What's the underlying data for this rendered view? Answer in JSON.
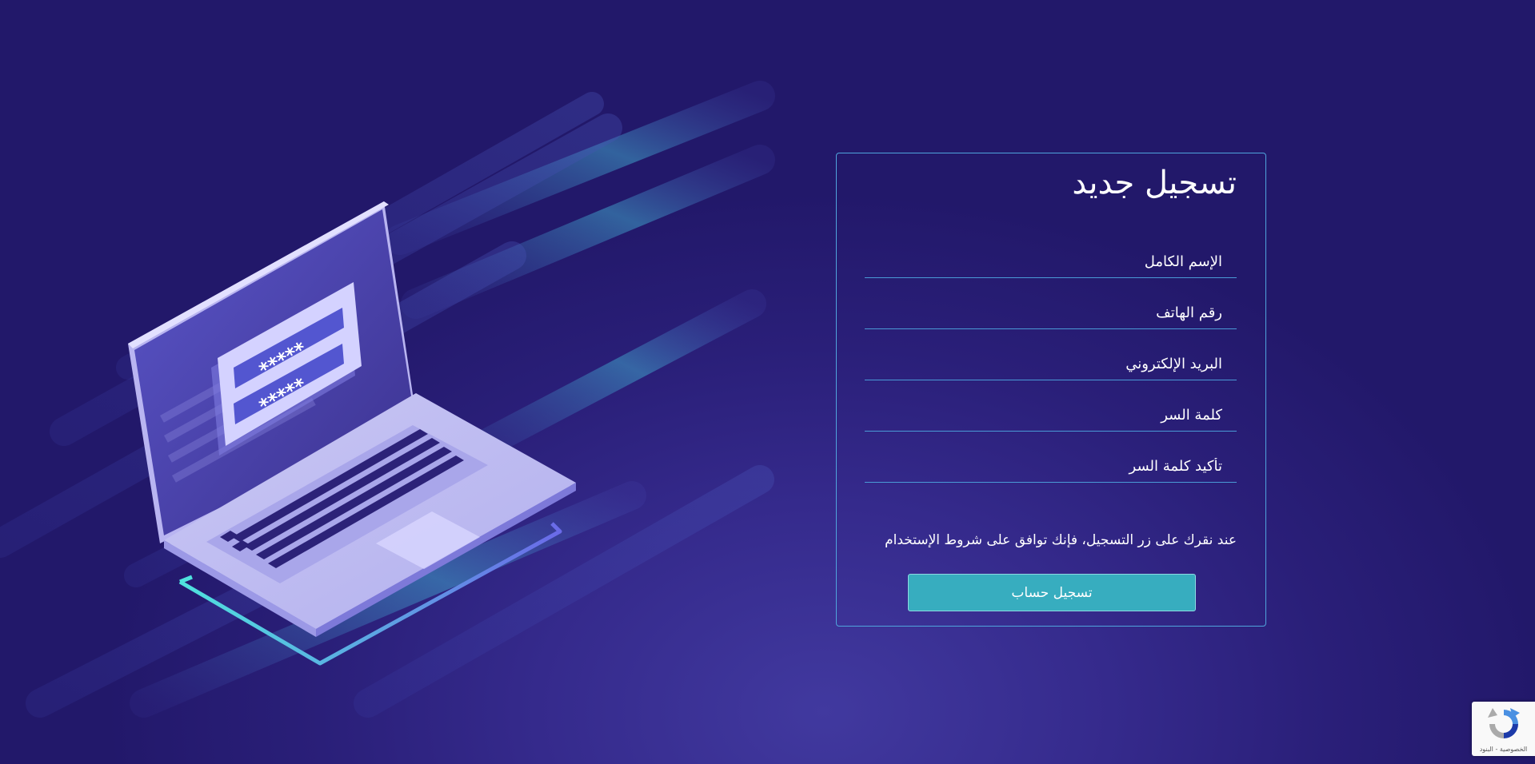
{
  "form": {
    "title": "تسجيل جديد",
    "fields": [
      {
        "name": "full-name",
        "placeholder": "الإسم الكامل",
        "value": ""
      },
      {
        "name": "phone",
        "placeholder": "رقم الهاتف",
        "value": ""
      },
      {
        "name": "email",
        "placeholder": "البريد الإلكتروني",
        "value": ""
      },
      {
        "name": "password",
        "placeholder": "كلمة السر",
        "value": ""
      },
      {
        "name": "confirm-password",
        "placeholder": "تأكيد كلمة السر",
        "value": ""
      }
    ],
    "terms_text": "عند نقرك على زر التسجيل، فإنك توافق على شروط الإستخدام",
    "submit_label": "تسجيل حساب"
  },
  "illustration": {
    "password_mask_1": "*****",
    "password_mask_2": "*****"
  },
  "recaptcha": {
    "links_text": "الخصوصية - البنود",
    "icon": "recaptcha-icon"
  },
  "colors": {
    "background": "#2a1f79",
    "card_border": "#4fa4dc",
    "button": "#37adbf",
    "text": "#ffffff"
  }
}
